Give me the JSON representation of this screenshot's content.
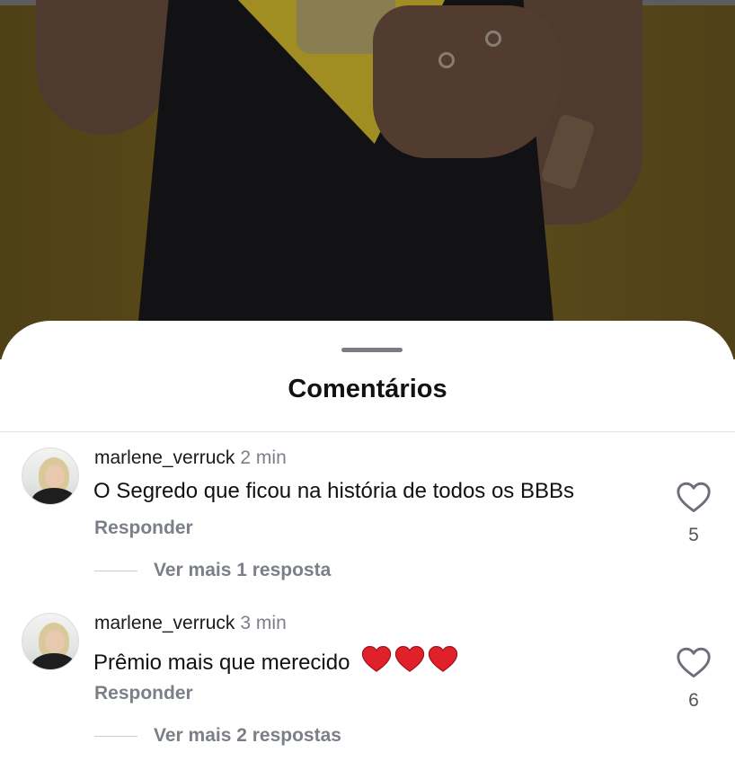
{
  "sheet": {
    "title": "Comentários"
  },
  "comments": [
    {
      "username": "marlene_verruck",
      "time": "2 min",
      "text": "O Segredo que ficou na história de todos os BBBs",
      "reply_label": "Responder",
      "more_replies": "Ver mais 1 resposta",
      "likes": "5"
    },
    {
      "username": "marlene_verruck",
      "time": "3 min",
      "text": "Prêmio mais que merecido",
      "emoji_hearts": 3,
      "reply_label": "Responder",
      "more_replies": "Ver mais 2 respostas",
      "likes": "6"
    }
  ],
  "colors": {
    "heart": "#e0212a",
    "muted": "#7b7f88"
  }
}
